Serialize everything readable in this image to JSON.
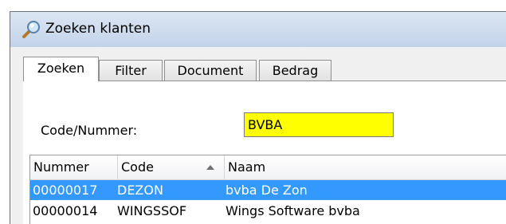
{
  "window": {
    "title": "Zoeken klanten",
    "icon": "magnifier-icon"
  },
  "tabs": [
    {
      "label": "Zoeken",
      "active": true
    },
    {
      "label": "Filter",
      "active": false
    },
    {
      "label": "Document",
      "active": false
    },
    {
      "label": "Bedrag",
      "active": false
    }
  ],
  "search": {
    "label": "Code/Nummer:",
    "value": "BVBA",
    "highlight_color": "#ffff00"
  },
  "grid": {
    "columns": [
      "Nummer",
      "Code",
      "Naam"
    ],
    "sort_column": "Code",
    "sort_direction": "ascending",
    "rows": [
      {
        "nummer": "00000017",
        "code": "DEZON",
        "naam": "bvba De Zon",
        "selected": true
      },
      {
        "nummer": "00000014",
        "code": "WINGSSOF",
        "naam": "Wings Software bvba",
        "selected": false
      }
    ],
    "selection_color": "#3399ff"
  }
}
